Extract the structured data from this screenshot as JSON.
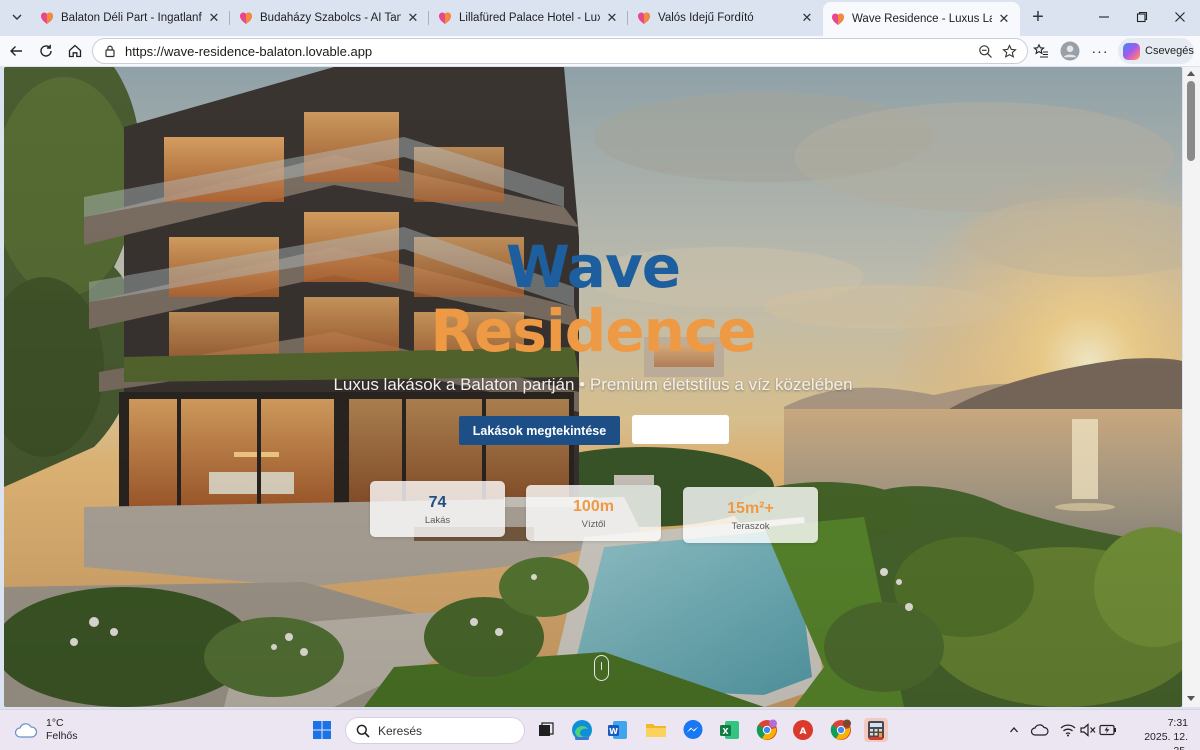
{
  "browser": {
    "tabs": [
      {
        "title": "Balaton Déli Part - Ingatlanfejleszt",
        "active": false
      },
      {
        "title": "Budaházy Szabolcs - AI Tanácsadó",
        "active": false
      },
      {
        "title": "Lillafüred Palace Hotel - Luxury He",
        "active": false
      },
      {
        "title": "Valós Idejű Fordító",
        "active": false
      },
      {
        "title": "Wave Residence - Luxus Lakások a",
        "active": true
      }
    ],
    "url": "https://wave-residence-balaton.lovable.app",
    "copilot_label": "Csevegés"
  },
  "hero": {
    "title_line1": "Wave",
    "title_line2": "Residence",
    "subtitle": "Luxus lakások a Balaton partján • Premium életstílus a víz közelében",
    "primary_button": "Lakások megtekintése",
    "secondary_button": "",
    "stats": [
      {
        "value": "74",
        "label": "Lakás"
      },
      {
        "value": "100m",
        "label": "Víztől"
      },
      {
        "value": "15m²+",
        "label": "Teraszok"
      }
    ]
  },
  "taskbar": {
    "weather_temp": "1°C",
    "weather_desc": "Felhős",
    "search_placeholder": "Keresés",
    "time": "7:31",
    "date": "2025. 12. 25."
  },
  "colors": {
    "title_blue": "#1d5f9e",
    "title_orange": "#ee9a45",
    "button_navy": "#1d4f86",
    "lovable_fav_pink": "#e9468b",
    "lovable_fav_orange": "#f28b3c"
  }
}
